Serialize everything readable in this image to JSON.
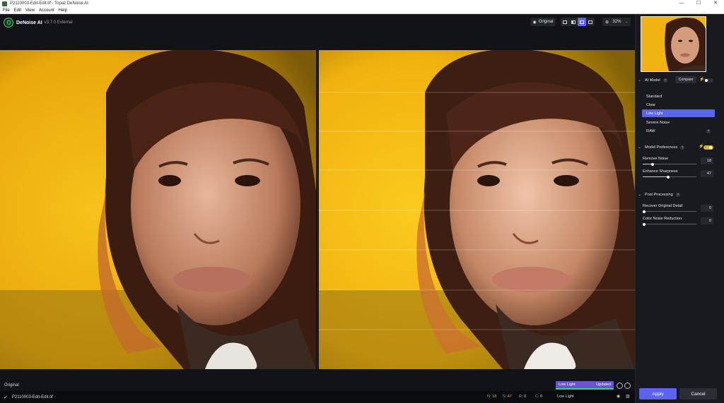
{
  "window": {
    "title": "P2110003-Edit-Edit.tif - Topaz DeNoise AI",
    "controls": [
      "—",
      "☐",
      "✕"
    ]
  },
  "menu": [
    "File",
    "Edit",
    "View",
    "Account",
    "Help"
  ],
  "app": {
    "name": "DeNoise AI",
    "version": "v3.7.0 External"
  },
  "toolbar": {
    "original_label": "Original",
    "zoom": "32%"
  },
  "preview": {
    "left_label": "Original",
    "model_badge": "Low Light",
    "status_badge": "Updated"
  },
  "filelist": {
    "filename": "P2110003-Edit-Edit.tif",
    "stats": [
      {
        "key": "N:",
        "value": "18"
      },
      {
        "key": "S:",
        "value": "47"
      },
      {
        "key": "R:",
        "value": "0"
      },
      {
        "key": "C:",
        "value": "0"
      }
    ],
    "model": "Low Light"
  },
  "sidebar": {
    "ai_model_title": "AI Model",
    "compare_label": "Compare",
    "models": [
      "Standard",
      "Clear",
      "Low Light",
      "Severe Noise",
      "RAW"
    ],
    "active_model": "Low Light",
    "prefs_title": "Model Preferences",
    "remove_noise": {
      "label": "Remove Noise",
      "value": "18"
    },
    "enhance_sharpness": {
      "label": "Enhance Sharpness",
      "value": "47"
    },
    "post_title": "Post Processing",
    "recover_detail": {
      "label": "Recover Original Detail",
      "value": "0"
    },
    "color_noise": {
      "label": "Color Noise Reduction",
      "value": "0"
    },
    "apply_label": "Apply",
    "cancel_label": "Cancel"
  },
  "colors": {
    "accent": "#5b63f0",
    "badge_purple": "#6a52d8",
    "background": "#111318",
    "image_yellow": "#f2b713"
  }
}
